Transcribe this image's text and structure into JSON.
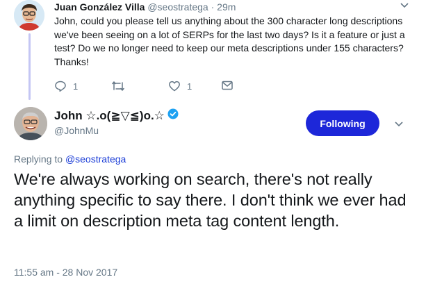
{
  "parent_tweet": {
    "name": "Juan González Villa",
    "handle": "@seostratega",
    "separator": "·",
    "time": "29m",
    "text": "John, could you please tell us anything about the 300 character long descriptions we've been seeing on a lot of SERPs for the last two days? Is it a feature or just a test? Do we no longer need to keep our meta descriptions under 155 characters? Thanks!",
    "actions": {
      "reply_count": "1",
      "retweet_count": "",
      "like_count": "1"
    }
  },
  "main_tweet": {
    "author_name": "John ☆.o(≧▽≦)o.☆",
    "author_handle": "@JohnMu",
    "follow_label": "Following",
    "replying_prefix": "Replying to",
    "replying_handle": "@seostratega",
    "text": "We're always working on search, there's not really anything specific to say there. I don't think we ever had a limit on description meta tag content length.",
    "timestamp": "11:55 am - 28 Nov 2017"
  },
  "colors": {
    "accent": "#1d27d9",
    "link": "#1b3dd7",
    "thread_line": "#c4c6f4",
    "muted": "#657786",
    "verified": "#1da1f2"
  },
  "icons": [
    "reply-icon",
    "retweet-icon",
    "like-icon",
    "direct-message-icon",
    "verified-badge-icon",
    "chevron-down-icon"
  ]
}
